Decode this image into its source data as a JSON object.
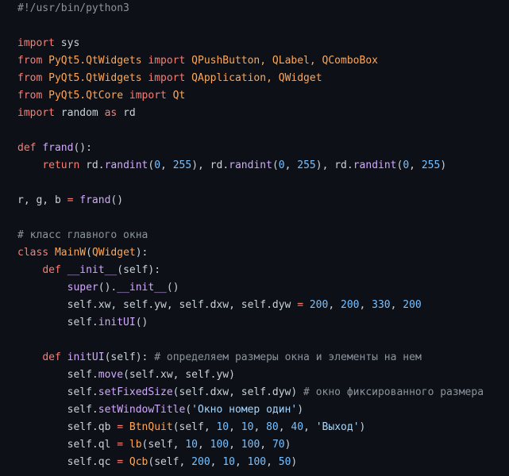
{
  "editor": {
    "language": "python",
    "colors": {
      "background": "#0d1117",
      "text": "#c9d1d9",
      "keyword": "#ff7b72",
      "function": "#d2a8ff",
      "number": "#79c0ff",
      "string": "#a5d6ff",
      "comment": "#8b949e",
      "class": "#ffa657"
    },
    "lines": [
      [
        {
          "t": "#!/usr/bin/python3",
          "c": "cm"
        }
      ],
      [],
      [
        {
          "t": "import",
          "c": "kw"
        },
        {
          "t": " sys"
        }
      ],
      [
        {
          "t": "from",
          "c": "kw"
        },
        {
          "t": " PyQt5.QtWidgets ",
          "c": "cls"
        },
        {
          "t": "import",
          "c": "kw"
        },
        {
          "t": " QPushButton, QLabel, QComboBox",
          "c": "cls"
        }
      ],
      [
        {
          "t": "from",
          "c": "kw"
        },
        {
          "t": " PyQt5.QtWidgets ",
          "c": "cls"
        },
        {
          "t": "import",
          "c": "kw"
        },
        {
          "t": " QApplication, QWidget",
          "c": "cls"
        }
      ],
      [
        {
          "t": "from",
          "c": "kw"
        },
        {
          "t": " PyQt5.QtCore ",
          "c": "cls"
        },
        {
          "t": "import",
          "c": "kw"
        },
        {
          "t": " Qt",
          "c": "cls"
        }
      ],
      [
        {
          "t": "import",
          "c": "kw"
        },
        {
          "t": " random "
        },
        {
          "t": "as",
          "c": "kw"
        },
        {
          "t": " rd"
        }
      ],
      [],
      [
        {
          "t": "def",
          "c": "kw"
        },
        {
          "t": " "
        },
        {
          "t": "frand",
          "c": "fn"
        },
        {
          "t": "():"
        }
      ],
      [
        {
          "t": "    "
        },
        {
          "t": "return",
          "c": "kw"
        },
        {
          "t": " rd."
        },
        {
          "t": "randint",
          "c": "fn"
        },
        {
          "t": "("
        },
        {
          "t": "0",
          "c": "num"
        },
        {
          "t": ", "
        },
        {
          "t": "255",
          "c": "num"
        },
        {
          "t": "), rd."
        },
        {
          "t": "randint",
          "c": "fn"
        },
        {
          "t": "("
        },
        {
          "t": "0",
          "c": "num"
        },
        {
          "t": ", "
        },
        {
          "t": "255",
          "c": "num"
        },
        {
          "t": "), rd."
        },
        {
          "t": "randint",
          "c": "fn"
        },
        {
          "t": "("
        },
        {
          "t": "0",
          "c": "num"
        },
        {
          "t": ", "
        },
        {
          "t": "255",
          "c": "num"
        },
        {
          "t": ")"
        }
      ],
      [],
      [
        {
          "t": "r, g, b "
        },
        {
          "t": "=",
          "c": "kw"
        },
        {
          "t": " "
        },
        {
          "t": "frand",
          "c": "fn"
        },
        {
          "t": "()"
        }
      ],
      [],
      [
        {
          "t": "# класс главного окна",
          "c": "cm"
        }
      ],
      [
        {
          "t": "class",
          "c": "kw"
        },
        {
          "t": " "
        },
        {
          "t": "MainW",
          "c": "cls"
        },
        {
          "t": "("
        },
        {
          "t": "QWidget",
          "c": "cls"
        },
        {
          "t": "):"
        }
      ],
      [
        {
          "t": "    "
        },
        {
          "t": "def",
          "c": "kw"
        },
        {
          "t": " "
        },
        {
          "t": "__init__",
          "c": "fn"
        },
        {
          "t": "(self):"
        }
      ],
      [
        {
          "t": "        "
        },
        {
          "t": "super",
          "c": "fn"
        },
        {
          "t": "()."
        },
        {
          "t": "__init__",
          "c": "fn"
        },
        {
          "t": "()"
        }
      ],
      [
        {
          "t": "        self.xw, self.yw, self.dxw, self.dyw "
        },
        {
          "t": "=",
          "c": "kw"
        },
        {
          "t": " "
        },
        {
          "t": "200",
          "c": "num"
        },
        {
          "t": ", "
        },
        {
          "t": "200",
          "c": "num"
        },
        {
          "t": ", "
        },
        {
          "t": "330",
          "c": "num"
        },
        {
          "t": ", "
        },
        {
          "t": "200",
          "c": "num"
        }
      ],
      [
        {
          "t": "        self."
        },
        {
          "t": "initUI",
          "c": "fn"
        },
        {
          "t": "()"
        }
      ],
      [],
      [
        {
          "t": "    "
        },
        {
          "t": "def",
          "c": "kw"
        },
        {
          "t": " "
        },
        {
          "t": "initUI",
          "c": "fn"
        },
        {
          "t": "(self): "
        },
        {
          "t": "# определяем размеры окна и элементы на нем",
          "c": "cm"
        }
      ],
      [
        {
          "t": "        self."
        },
        {
          "t": "move",
          "c": "fn"
        },
        {
          "t": "(self.xw, self.yw)"
        }
      ],
      [
        {
          "t": "        self."
        },
        {
          "t": "setFixedSize",
          "c": "fn"
        },
        {
          "t": "(self.dxw, self.dyw) "
        },
        {
          "t": "# окно фиксированного размера",
          "c": "cm"
        }
      ],
      [
        {
          "t": "        self."
        },
        {
          "t": "setWindowTitle",
          "c": "fn"
        },
        {
          "t": "("
        },
        {
          "t": "'Окно номер один'",
          "c": "str"
        },
        {
          "t": ")"
        }
      ],
      [
        {
          "t": "        self.qb "
        },
        {
          "t": "=",
          "c": "kw"
        },
        {
          "t": " "
        },
        {
          "t": "BtnQuit",
          "c": "cls"
        },
        {
          "t": "(self, "
        },
        {
          "t": "10",
          "c": "num"
        },
        {
          "t": ", "
        },
        {
          "t": "10",
          "c": "num"
        },
        {
          "t": ", "
        },
        {
          "t": "80",
          "c": "num"
        },
        {
          "t": ", "
        },
        {
          "t": "40",
          "c": "num"
        },
        {
          "t": ", "
        },
        {
          "t": "'Выход'",
          "c": "str"
        },
        {
          "t": ")"
        }
      ],
      [
        {
          "t": "        self.ql "
        },
        {
          "t": "=",
          "c": "kw"
        },
        {
          "t": " "
        },
        {
          "t": "lb",
          "c": "cls"
        },
        {
          "t": "(self, "
        },
        {
          "t": "10",
          "c": "num"
        },
        {
          "t": ", "
        },
        {
          "t": "100",
          "c": "num"
        },
        {
          "t": ", "
        },
        {
          "t": "100",
          "c": "num"
        },
        {
          "t": ", "
        },
        {
          "t": "70",
          "c": "num"
        },
        {
          "t": ")"
        }
      ],
      [
        {
          "t": "        self.qc "
        },
        {
          "t": "=",
          "c": "kw"
        },
        {
          "t": " "
        },
        {
          "t": "Qcb",
          "c": "cls"
        },
        {
          "t": "(self, "
        },
        {
          "t": "200",
          "c": "num"
        },
        {
          "t": ", "
        },
        {
          "t": "10",
          "c": "num"
        },
        {
          "t": ", "
        },
        {
          "t": "100",
          "c": "num"
        },
        {
          "t": ", "
        },
        {
          "t": "50",
          "c": "num"
        },
        {
          "t": ")"
        }
      ]
    ]
  }
}
